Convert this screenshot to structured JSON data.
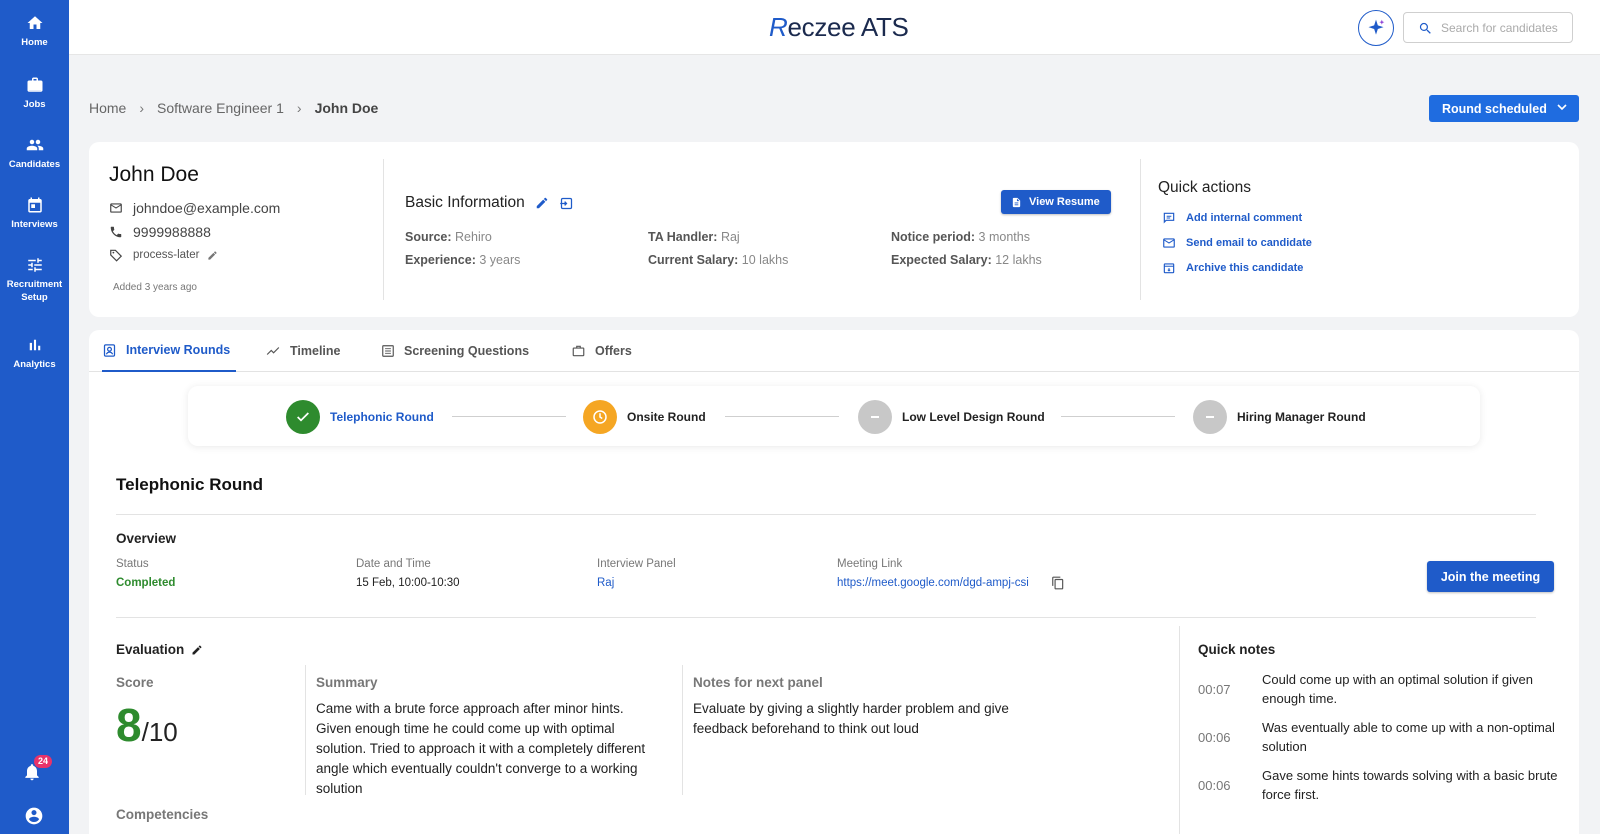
{
  "sidebar": {
    "items": [
      {
        "label": "Home",
        "icon": "home-icon"
      },
      {
        "label": "Jobs",
        "icon": "briefcase-icon"
      },
      {
        "label": "Candidates",
        "icon": "people-icon"
      },
      {
        "label": "Interviews",
        "icon": "calendar-icon"
      },
      {
        "label": "Recruitment Setup",
        "icon": "sliders-icon"
      },
      {
        "label": "Analytics",
        "icon": "bar-chart-icon"
      }
    ],
    "notification_count": "24"
  },
  "header": {
    "logo_r": "R",
    "logo_rest": "eczee ATS",
    "search_placeholder": "Search for candidates"
  },
  "breadcrumb": [
    "Home",
    "Software Engineer 1",
    "John Doe"
  ],
  "status_button": "Round scheduled",
  "candidate": {
    "name": "John Doe",
    "email": "johndoe@example.com",
    "phone": "9999988888",
    "tag": "process-later",
    "added": "Added 3 years ago"
  },
  "basic_info": {
    "title": "Basic Information",
    "view_resume": "View Resume",
    "fields": [
      {
        "label": "Source:",
        "value": "Rehiro"
      },
      {
        "label": "Experience:",
        "value": "3 years"
      },
      {
        "label": "TA Handler:",
        "value": "Raj"
      },
      {
        "label": "Current Salary:",
        "value": "10 lakhs"
      },
      {
        "label": "Notice period:",
        "value": "3 months"
      },
      {
        "label": "Expected Salary:",
        "value": "12 lakhs"
      }
    ]
  },
  "quick_actions": {
    "title": "Quick actions",
    "items": [
      "Add internal comment",
      "Send email to candidate",
      "Archive this candidate"
    ]
  },
  "tabs": [
    "Interview Rounds",
    "Timeline",
    "Screening Questions",
    "Offers"
  ],
  "rounds": [
    {
      "name": "Telephonic Round",
      "state": "completed"
    },
    {
      "name": "Onsite Round",
      "state": "scheduled"
    },
    {
      "name": "Low Level Design Round",
      "state": "pending"
    },
    {
      "name": "Hiring Manager Round",
      "state": "pending"
    }
  ],
  "colors": {
    "primary": "#1f5bc9",
    "success": "#2e8b2e",
    "warning": "#f5a623",
    "pending": "#c8c8c8"
  },
  "round_detail": {
    "title": "Telephonic Round",
    "overview_title": "Overview",
    "overview": {
      "status_label": "Status",
      "status_value": "Completed",
      "datetime_label": "Date and Time",
      "datetime_value": "15 Feb, 10:00-10:30",
      "panel_label": "Interview Panel",
      "panel_value": "Raj",
      "link_label": "Meeting Link",
      "link_value": "https://meet.google.com/dgd-ampj-csi"
    },
    "join_button": "Join the meeting",
    "evaluation_title": "Evaluation",
    "score_label": "Score",
    "score_value": "8",
    "score_denominator": "/10",
    "summary_label": "Summary",
    "summary_lines": [
      "Came with a brute force approach after minor hints.",
      "Given enough time he could come up with optimal",
      "solution. Tried to approach it with a completely different",
      "angle which eventually couldn't converge to a working",
      "solution"
    ],
    "notes_label": "Notes for next panel",
    "notes_lines": [
      "Evaluate by giving a slightly harder problem and give",
      "feedback beforehand to think out loud"
    ],
    "competencies_label": "Competencies"
  },
  "quick_notes": {
    "title": "Quick notes",
    "items": [
      {
        "time": "00:07",
        "text": "Could come up with an optimal solution if given enough time."
      },
      {
        "time": "00:06",
        "text": "Was eventually able to come up with a non-optimal solution"
      },
      {
        "time": "00:06",
        "text": "Gave some hints towards solving with a basic brute force first."
      }
    ]
  }
}
